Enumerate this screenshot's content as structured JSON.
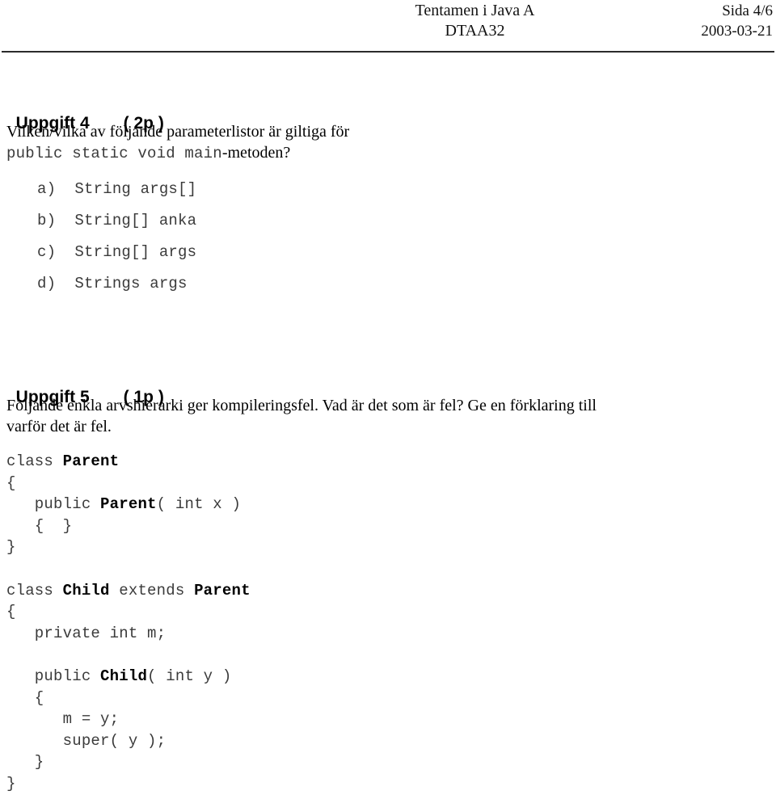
{
  "document": {
    "header": {
      "course_title": "Tentamen i Java A",
      "course_code": "DTAA32",
      "page_label": "Sida 4/6",
      "date": "2003-03-21"
    },
    "tasks": [
      {
        "title": "Uppgift 4",
        "points": "( 2p )",
        "question_line1": "Vilken/vilka av följande parameterlistor är giltiga för",
        "question_code": "public static void main",
        "question_tail": "-metoden?",
        "options": [
          "a)  String args[]",
          "b)  String[] anka",
          "c)  String[] args",
          "d)  Strings args"
        ]
      },
      {
        "title": "Uppgift 5",
        "points": "( 1p )",
        "description_line1": "Följande enkla arvshierarki ger kompileringsfel. Vad är det som är fel? Ge en förklaring till",
        "description_line2": "varför det är fel.",
        "code_lines": [
          [
            {
              "t": "class ",
              "b": false
            },
            {
              "t": "Parent",
              "b": true
            }
          ],
          [
            {
              "t": "{",
              "b": false
            }
          ],
          [
            {
              "t": "   public ",
              "b": false
            },
            {
              "t": "Parent",
              "b": true
            },
            {
              "t": "( int x )",
              "b": false
            }
          ],
          [
            {
              "t": "   {  }",
              "b": false
            }
          ],
          [
            {
              "t": "}",
              "b": false
            }
          ],
          [
            {
              "t": "",
              "b": false
            }
          ],
          [
            {
              "t": "class ",
              "b": false
            },
            {
              "t": "Child",
              "b": true
            },
            {
              "t": " extends ",
              "b": false
            },
            {
              "t": "Parent",
              "b": true
            }
          ],
          [
            {
              "t": "{",
              "b": false
            }
          ],
          [
            {
              "t": "   private int m;",
              "b": false
            }
          ],
          [
            {
              "t": "",
              "b": false
            }
          ],
          [
            {
              "t": "   public ",
              "b": false
            },
            {
              "t": "Child",
              "b": true
            },
            {
              "t": "( int y )",
              "b": false
            }
          ],
          [
            {
              "t": "   {",
              "b": false
            }
          ],
          [
            {
              "t": "      m = y;",
              "b": false
            }
          ],
          [
            {
              "t": "      super( y );",
              "b": false
            }
          ],
          [
            {
              "t": "   }",
              "b": false
            }
          ],
          [
            {
              "t": "}",
              "b": false
            }
          ]
        ]
      }
    ],
    "colors": {
      "text": "#000000",
      "code_text": "#3b3b3b",
      "rule": "#2b2b2b",
      "background": "#ffffff"
    }
  }
}
